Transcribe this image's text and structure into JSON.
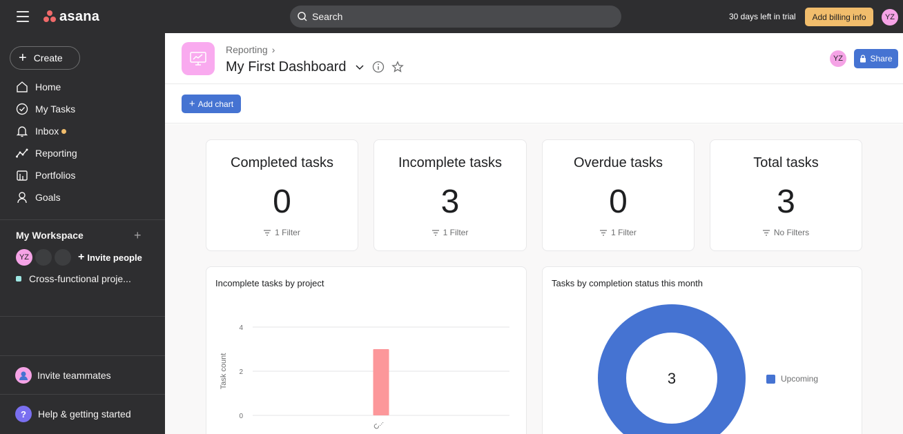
{
  "topbar": {
    "logo_text": "asana",
    "search_placeholder": "Search",
    "trial_text": "30 days left in trial",
    "billing_label": "Add billing info",
    "user_initials": "YZ"
  },
  "sidebar": {
    "create_label": "Create",
    "nav": [
      {
        "label": "Home",
        "icon": "home-icon"
      },
      {
        "label": "My Tasks",
        "icon": "check-circle-icon"
      },
      {
        "label": "Inbox",
        "icon": "bell-icon"
      },
      {
        "label": "Reporting",
        "icon": "reporting-icon"
      },
      {
        "label": "Portfolios",
        "icon": "portfolio-icon"
      },
      {
        "label": "Goals",
        "icon": "goals-icon"
      }
    ],
    "workspace_title": "My Workspace",
    "workspace_avatar": "YZ",
    "invite_people": "Invite people",
    "project_name": "Cross-functional proje...",
    "project_color": "#9ee7e3",
    "invite_teammates": "Invite teammates",
    "help": "Help & getting started"
  },
  "header": {
    "breadcrumb": "Reporting",
    "title": "My First Dashboard",
    "user_initials": "YZ",
    "share_label": "Share"
  },
  "toolbar": {
    "add_chart_label": "Add chart"
  },
  "stats": [
    {
      "title": "Completed tasks",
      "value": "0",
      "filter": "1 Filter"
    },
    {
      "title": "Incomplete tasks",
      "value": "3",
      "filter": "1 Filter"
    },
    {
      "title": "Overdue tasks",
      "value": "0",
      "filter": "1 Filter"
    },
    {
      "title": "Total tasks",
      "value": "3",
      "filter": "No Filters"
    }
  ],
  "chart_data": [
    {
      "type": "bar",
      "title": "Incomplete tasks by project",
      "ylabel": "Task count",
      "xlabel": "",
      "categories": [
        "C..."
      ],
      "values": [
        3
      ],
      "ylim": [
        0,
        4
      ],
      "yticks": [
        0,
        2,
        4
      ],
      "bar_color": "#fc979a",
      "grid": true
    },
    {
      "type": "pie",
      "title": "Tasks by completion status this month",
      "center_label": "3",
      "slices": [
        {
          "label": "Upcoming",
          "value": 3,
          "color": "#4573d2"
        }
      ],
      "legend": "right"
    }
  ],
  "colors": {
    "accent": "#4573d2",
    "billing": "#f1bd6c",
    "avatar": "#f5a3e6",
    "sidebar_bg": "#2e2e30"
  }
}
